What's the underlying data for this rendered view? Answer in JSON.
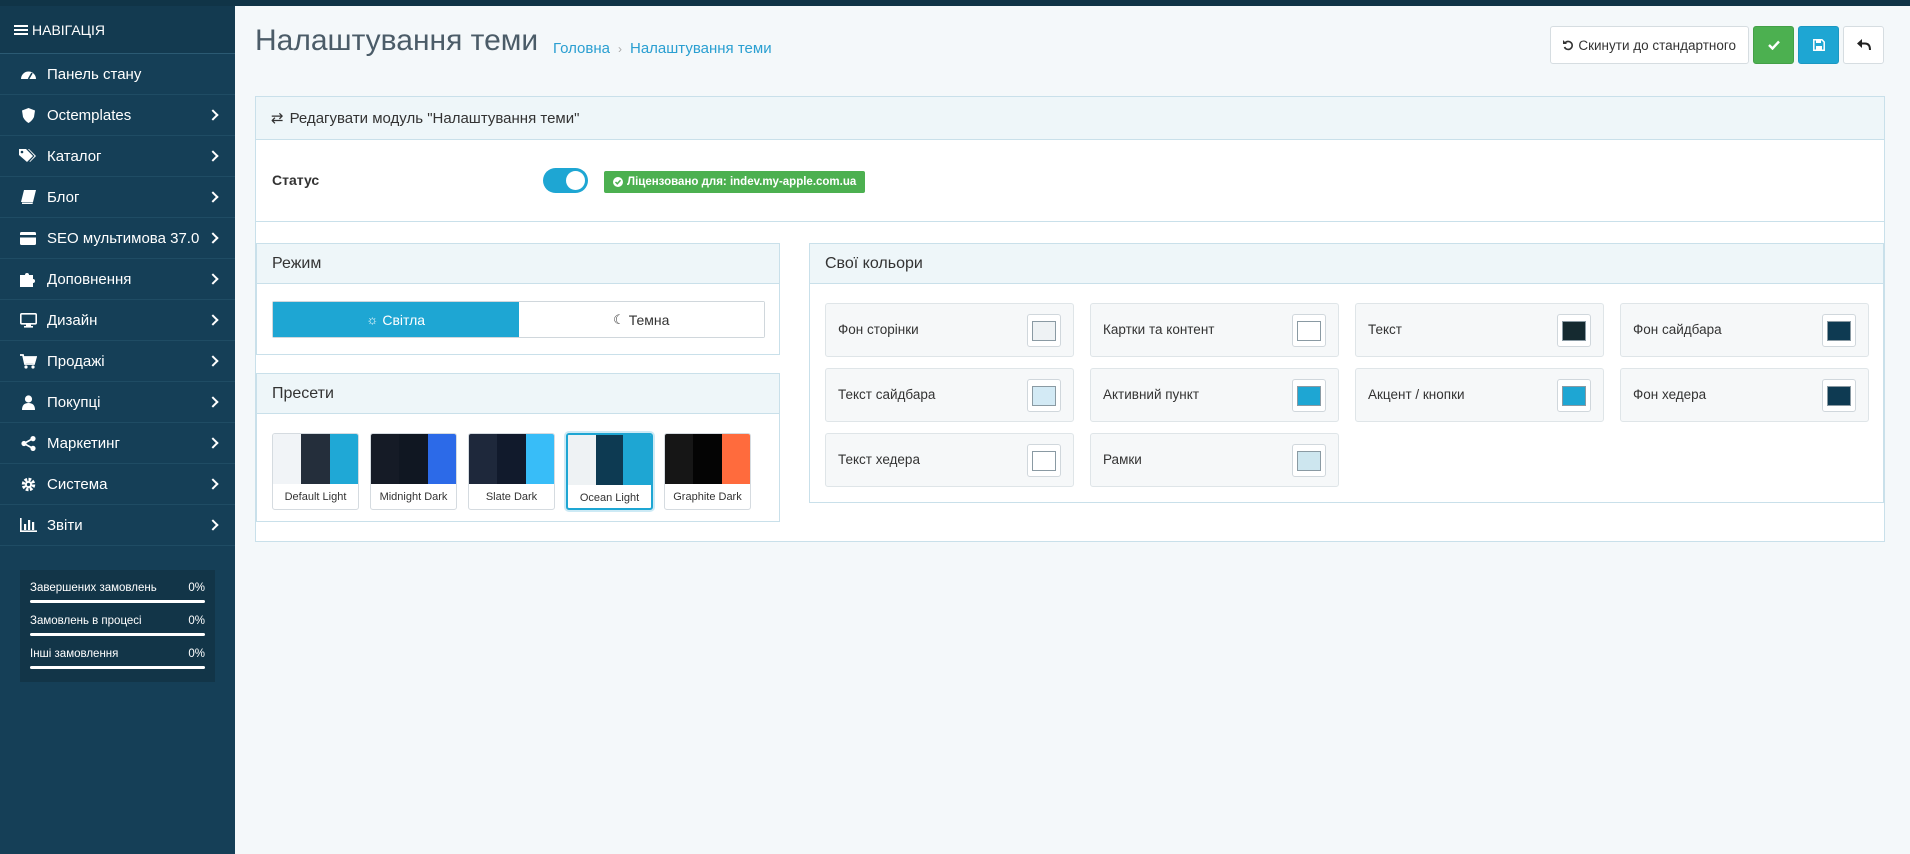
{
  "sidebar": {
    "header": "НАВІГАЦІЯ",
    "items": [
      {
        "label": "Панель стану",
        "icon": "dashboard-icon",
        "has_chevron": false
      },
      {
        "label": "Octemplates",
        "icon": "shield-icon",
        "has_chevron": true
      },
      {
        "label": "Каталог",
        "icon": "tags-icon",
        "has_chevron": true
      },
      {
        "label": "Блог",
        "icon": "book-icon",
        "has_chevron": true
      },
      {
        "label": "SEO мультимова 37.0",
        "icon": "credit-card-icon",
        "has_chevron": true
      },
      {
        "label": "Доповнення",
        "icon": "puzzle-icon",
        "has_chevron": true
      },
      {
        "label": "Дизайн",
        "icon": "monitor-icon",
        "has_chevron": true
      },
      {
        "label": "Продажі",
        "icon": "cart-icon",
        "has_chevron": true
      },
      {
        "label": "Покупці",
        "icon": "user-icon",
        "has_chevron": true
      },
      {
        "label": "Маркетинг",
        "icon": "share-icon",
        "has_chevron": true
      },
      {
        "label": "Система",
        "icon": "gear-icon",
        "has_chevron": true
      },
      {
        "label": "Звіти",
        "icon": "bar-chart-icon",
        "has_chevron": true
      }
    ],
    "stats": [
      {
        "label": "Завершених замовлень",
        "value": "0%"
      },
      {
        "label": "Замовлень в процесі",
        "value": "0%"
      },
      {
        "label": "Інші замовлення",
        "value": "0%"
      }
    ]
  },
  "header": {
    "title": "Налаштування теми",
    "breadcrumb": [
      "Головна",
      "Налаштування теми"
    ],
    "reset_label": "Скинути до стандартного"
  },
  "panel": {
    "title": "Редагувати модуль \"Налаштування теми\"",
    "status_label": "Статус",
    "status_enabled": true,
    "license_text": "Ліцензовано для: indev.my-apple.com.ua"
  },
  "mode": {
    "title": "Режим",
    "light_label": "Світла",
    "dark_label": "Темна",
    "selected": "light"
  },
  "presets": {
    "title": "Пресети",
    "items": [
      {
        "name": "Default Light",
        "colors": [
          "#f1f4f7",
          "#242e3b",
          "#1fa8d6"
        ],
        "selected": false
      },
      {
        "name": "Midnight Dark",
        "colors": [
          "#151b26",
          "#101722",
          "#2c6ae8"
        ],
        "selected": false
      },
      {
        "name": "Slate Dark",
        "colors": [
          "#1e283b",
          "#111a2c",
          "#38bdf8"
        ],
        "selected": false
      },
      {
        "name": "Ocean Light",
        "colors": [
          "#eef2f4",
          "#0d3a52",
          "#1ea6d3"
        ],
        "selected": true
      },
      {
        "name": "Graphite Dark",
        "colors": [
          "#161616",
          "#040404",
          "#ff6b3d"
        ],
        "selected": false
      }
    ]
  },
  "colors": {
    "title": "Свої кольори",
    "items": [
      {
        "label": "Фон сторінки",
        "value": "#eef2f4"
      },
      {
        "label": "Картки та контент",
        "value": "#ffffff"
      },
      {
        "label": "Текст",
        "value": "#152a30"
      },
      {
        "label": "Фон сайдбара",
        "value": "#0e3a52"
      },
      {
        "label": "Текст сайдбара",
        "value": "#d3eaf5"
      },
      {
        "label": "Активний пункт",
        "value": "#1ea6d3"
      },
      {
        "label": "Акцент / кнопки",
        "value": "#1ea6d3"
      },
      {
        "label": "Фон хедера",
        "value": "#0e3a52"
      },
      {
        "label": "Текст хедера",
        "value": "#ffffff"
      },
      {
        "label": "Рамки",
        "value": "#cde6ef"
      }
    ]
  }
}
